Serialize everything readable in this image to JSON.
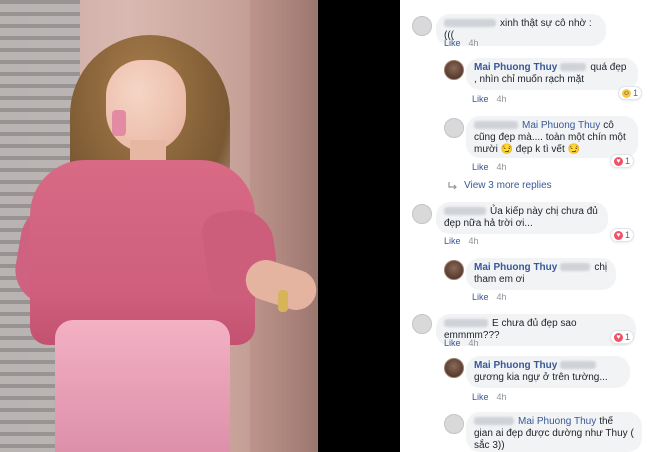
{
  "comments": [
    {
      "text": "xinh thật sự cô nhờ :(((",
      "meta": {
        "like": "Like",
        "time": "4h"
      }
    },
    {
      "author": "Mai Phuong Thuy",
      "text": "quá đẹp , nhìn chỉ muốn rạch mặt",
      "meta": {
        "like": "Like",
        "time": "4h"
      },
      "reaction": {
        "type": "haha-icon",
        "count": "1"
      }
    },
    {
      "tag": "Mai Phuong Thuy",
      "text": "cô cũng đẹp mà.... toàn một chín một mười 😏 đẹp k tì vết 😏",
      "meta": {
        "like": "Like",
        "time": "4h"
      },
      "reaction": {
        "type": "heart-icon",
        "count": "1"
      }
    },
    {
      "text": "Ủa kiếp này chị chưa đủ đẹp nữa hả trời ơi...",
      "meta": {
        "like": "Like",
        "time": "4h"
      },
      "reaction": {
        "type": "heart-icon",
        "count": "1"
      }
    },
    {
      "author": "Mai Phuong Thuy",
      "text": "chị tham em ơi",
      "meta": {
        "like": "Like",
        "time": "4h"
      }
    },
    {
      "text": "E chưa đủ đẹp sao emmmm???",
      "meta": {
        "like": "Like",
        "time": "4h"
      },
      "reaction": {
        "type": "heart-icon",
        "count": "1"
      }
    },
    {
      "author": "Mai Phuong Thuy",
      "text": "gương kia ngự ở trên tường...",
      "meta": {
        "like": "Like",
        "time": "4h"
      }
    },
    {
      "tag": "Mai Phuong Thuy",
      "text": "thế gian ai đẹp được dường như Thuy ( sắc 3))"
    }
  ],
  "view_more": "View 3 more replies",
  "colors": {
    "link": "#385898",
    "bubble": "#f2f3f5",
    "meta": "#90949c"
  }
}
